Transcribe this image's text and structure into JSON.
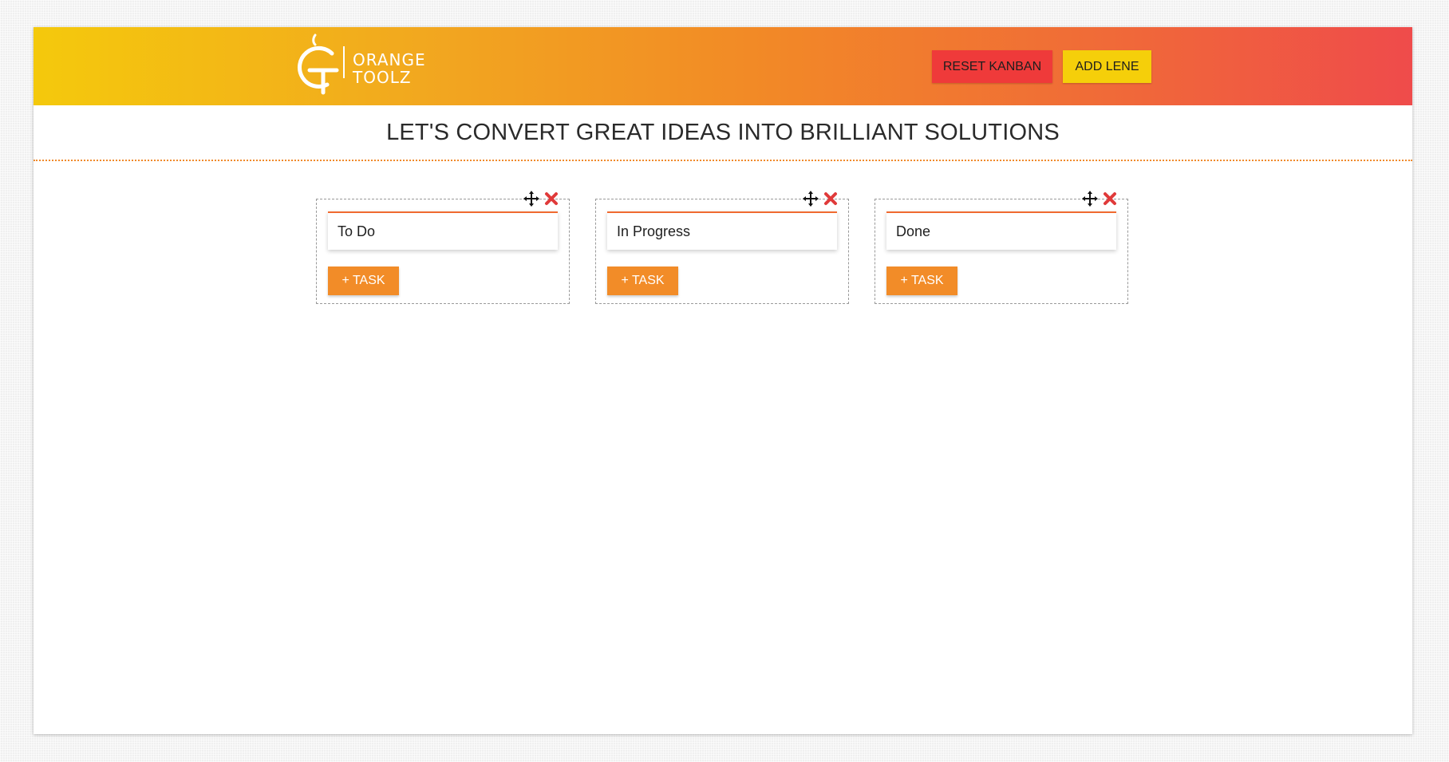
{
  "brand": {
    "line1": "ORANGE",
    "line2": "TOOLZ",
    "logo_icon": "orange-toolz-logo-icon"
  },
  "header": {
    "reset_label": "RESET KANBAN",
    "add_lane_label": "ADD LENE"
  },
  "tagline": "LET'S CONVERT GREAT IDEAS INTO BRILLIANT SOLUTIONS",
  "lanes": [
    {
      "title": "To Do",
      "task_label": "+ TASK"
    },
    {
      "title": "In Progress",
      "task_label": "+ TASK"
    },
    {
      "title": "Done",
      "task_label": "+ TASK"
    }
  ],
  "icons": {
    "move": "move-icon",
    "close": "close-icon"
  },
  "colors": {
    "header_gradient": [
      "#f4c90c",
      "#f28a26",
      "#ef4b4b"
    ],
    "reset_button": "#ef3a3a",
    "add_button": "#f5cf0a",
    "task_button": "#f28c28",
    "lane_accent": "#f06a30",
    "close_icon": "#e03a3a"
  }
}
